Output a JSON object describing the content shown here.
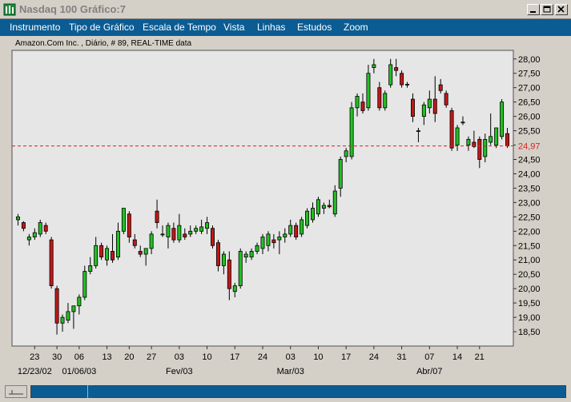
{
  "window": {
    "title": "Nasdaq 100 Gráfico:7",
    "minimize_icon": "minimize-icon",
    "maximize_icon": "maximize-icon",
    "close_icon": "close-icon"
  },
  "menu": {
    "items": [
      "Instrumento",
      "Tipo de Gráfico",
      "Escala de Tempo",
      "Vista",
      "Linhas",
      "Estudos",
      "Zoom"
    ]
  },
  "chart_header": "Amazon.Com Inc. , Diário, # 89, REAL-TIME data",
  "colors": {
    "up_candle": "#22c022",
    "down_candle": "#c01818",
    "reference_line": "#e02020",
    "menu_bg": "#0b5c93",
    "plot_bg": "#e6e6e6"
  },
  "chart_data": {
    "type": "candlestick",
    "y_ticks": [
      "28,00",
      "27,50",
      "27,00",
      "26,50",
      "26,00",
      "25,50",
      "25,00",
      "24,50",
      "24,00",
      "23,50",
      "23,00",
      "22,50",
      "22,00",
      "21,50",
      "21,00",
      "20,50",
      "20,00",
      "19,50",
      "19,00",
      "18,50"
    ],
    "ylim": [
      18.0,
      28.3
    ],
    "reference_line": {
      "value": 24.97,
      "label": "24,97"
    },
    "x_day_ticks": [
      {
        "label": "23",
        "index": 3
      },
      {
        "label": "30",
        "index": 7
      },
      {
        "label": "06",
        "index": 11
      },
      {
        "label": "13",
        "index": 16
      },
      {
        "label": "20",
        "index": 20
      },
      {
        "label": "27",
        "index": 24
      },
      {
        "label": "03",
        "index": 29
      },
      {
        "label": "10",
        "index": 34
      },
      {
        "label": "17",
        "index": 39
      },
      {
        "label": "24",
        "index": 44
      },
      {
        "label": "03",
        "index": 49
      },
      {
        "label": "10",
        "index": 54
      },
      {
        "label": "17",
        "index": 59
      },
      {
        "label": "24",
        "index": 64
      },
      {
        "label": "31",
        "index": 69
      },
      {
        "label": "07",
        "index": 74
      },
      {
        "label": "14",
        "index": 79
      },
      {
        "label": "21",
        "index": 83
      }
    ],
    "x_period_labels": [
      {
        "label": "12/23/02",
        "index": 3
      },
      {
        "label": "01/06/03",
        "index": 11
      },
      {
        "label": "Fev/03",
        "index": 29
      },
      {
        "label": "Mar/03",
        "index": 49
      },
      {
        "label": "Abr/07",
        "index": 74
      }
    ],
    "candles": [
      {
        "o": 22.4,
        "h": 22.6,
        "l": 22.2,
        "c": 22.5
      },
      {
        "o": 22.3,
        "h": 22.35,
        "l": 22.0,
        "c": 22.1
      },
      {
        "o": 21.7,
        "h": 21.9,
        "l": 21.5,
        "c": 21.8
      },
      {
        "o": 21.8,
        "h": 22.1,
        "l": 21.7,
        "c": 21.95
      },
      {
        "o": 21.9,
        "h": 22.4,
        "l": 21.8,
        "c": 22.3
      },
      {
        "o": 22.2,
        "h": 22.3,
        "l": 21.9,
        "c": 22.0
      },
      {
        "o": 21.7,
        "h": 21.8,
        "l": 20.0,
        "c": 20.1
      },
      {
        "o": 20.0,
        "h": 20.1,
        "l": 18.4,
        "c": 18.8
      },
      {
        "o": 18.8,
        "h": 19.1,
        "l": 18.5,
        "c": 19.0
      },
      {
        "o": 18.9,
        "h": 19.5,
        "l": 18.8,
        "c": 19.2
      },
      {
        "o": 19.2,
        "h": 19.3,
        "l": 18.6,
        "c": 19.4
      },
      {
        "o": 19.4,
        "h": 19.8,
        "l": 19.1,
        "c": 19.7
      },
      {
        "o": 19.7,
        "h": 20.8,
        "l": 19.6,
        "c": 20.6
      },
      {
        "o": 20.6,
        "h": 21.1,
        "l": 20.5,
        "c": 20.8
      },
      {
        "o": 20.8,
        "h": 21.8,
        "l": 20.7,
        "c": 21.5
      },
      {
        "o": 21.5,
        "h": 21.6,
        "l": 21.0,
        "c": 21.1
      },
      {
        "o": 21.0,
        "h": 21.5,
        "l": 20.8,
        "c": 21.4
      },
      {
        "o": 21.3,
        "h": 21.9,
        "l": 20.9,
        "c": 21.0
      },
      {
        "o": 21.1,
        "h": 22.3,
        "l": 21.0,
        "c": 22.0
      },
      {
        "o": 22.0,
        "h": 22.8,
        "l": 21.9,
        "c": 22.8
      },
      {
        "o": 22.6,
        "h": 22.7,
        "l": 21.6,
        "c": 21.8
      },
      {
        "o": 21.7,
        "h": 21.9,
        "l": 21.4,
        "c": 21.5
      },
      {
        "o": 21.3,
        "h": 21.5,
        "l": 21.1,
        "c": 21.2
      },
      {
        "o": 21.2,
        "h": 21.3,
        "l": 20.8,
        "c": 21.4
      },
      {
        "o": 21.4,
        "h": 22.0,
        "l": 21.2,
        "c": 21.9
      },
      {
        "o": 22.7,
        "h": 23.1,
        "l": 22.1,
        "c": 22.3
      },
      {
        "o": 21.9,
        "h": 22.2,
        "l": 21.8,
        "c": 21.9
      },
      {
        "o": 21.8,
        "h": 22.3,
        "l": 21.4,
        "c": 22.2
      },
      {
        "o": 22.1,
        "h": 22.3,
        "l": 21.6,
        "c": 21.7
      },
      {
        "o": 21.7,
        "h": 22.6,
        "l": 21.6,
        "c": 22.2
      },
      {
        "o": 21.9,
        "h": 22.1,
        "l": 21.7,
        "c": 21.8
      },
      {
        "o": 21.9,
        "h": 22.2,
        "l": 21.8,
        "c": 22.0
      },
      {
        "o": 22.0,
        "h": 22.2,
        "l": 21.9,
        "c": 22.1
      },
      {
        "o": 22.0,
        "h": 22.4,
        "l": 21.9,
        "c": 22.15
      },
      {
        "o": 22.1,
        "h": 22.5,
        "l": 21.9,
        "c": 22.3
      },
      {
        "o": 22.1,
        "h": 22.2,
        "l": 21.4,
        "c": 21.5
      },
      {
        "o": 21.6,
        "h": 21.7,
        "l": 20.6,
        "c": 20.8
      },
      {
        "o": 20.8,
        "h": 21.3,
        "l": 20.5,
        "c": 21.2
      },
      {
        "o": 21.0,
        "h": 21.3,
        "l": 19.6,
        "c": 20.0
      },
      {
        "o": 19.9,
        "h": 20.2,
        "l": 19.7,
        "c": 20.1
      },
      {
        "o": 20.1,
        "h": 21.4,
        "l": 20.0,
        "c": 21.3
      },
      {
        "o": 21.1,
        "h": 21.3,
        "l": 20.9,
        "c": 21.2
      },
      {
        "o": 21.1,
        "h": 21.4,
        "l": 21.0,
        "c": 21.3
      },
      {
        "o": 21.3,
        "h": 21.6,
        "l": 21.2,
        "c": 21.5
      },
      {
        "o": 21.4,
        "h": 21.9,
        "l": 21.2,
        "c": 21.8
      },
      {
        "o": 21.5,
        "h": 22.0,
        "l": 21.3,
        "c": 21.9
      },
      {
        "o": 21.7,
        "h": 21.9,
        "l": 21.4,
        "c": 21.6
      },
      {
        "o": 21.7,
        "h": 22.0,
        "l": 21.2,
        "c": 21.8
      },
      {
        "o": 21.8,
        "h": 22.1,
        "l": 21.6,
        "c": 21.9
      },
      {
        "o": 21.9,
        "h": 22.4,
        "l": 21.8,
        "c": 22.2
      },
      {
        "o": 22.2,
        "h": 22.3,
        "l": 21.7,
        "c": 21.8
      },
      {
        "o": 21.9,
        "h": 22.5,
        "l": 21.8,
        "c": 22.4
      },
      {
        "o": 22.2,
        "h": 22.8,
        "l": 22.1,
        "c": 22.7
      },
      {
        "o": 22.4,
        "h": 23.0,
        "l": 22.3,
        "c": 22.8
      },
      {
        "o": 22.6,
        "h": 23.2,
        "l": 22.5,
        "c": 23.1
      },
      {
        "o": 22.8,
        "h": 23.0,
        "l": 22.6,
        "c": 22.9
      },
      {
        "o": 22.9,
        "h": 23.1,
        "l": 22.8,
        "c": 22.85
      },
      {
        "o": 22.6,
        "h": 23.6,
        "l": 22.5,
        "c": 23.4
      },
      {
        "o": 23.5,
        "h": 24.6,
        "l": 23.2,
        "c": 24.5
      },
      {
        "o": 24.6,
        "h": 24.9,
        "l": 24.4,
        "c": 24.8
      },
      {
        "o": 24.6,
        "h": 26.5,
        "l": 24.5,
        "c": 26.3
      },
      {
        "o": 26.3,
        "h": 26.8,
        "l": 26.0,
        "c": 26.7
      },
      {
        "o": 26.5,
        "h": 26.8,
        "l": 26.1,
        "c": 26.2
      },
      {
        "o": 26.3,
        "h": 27.8,
        "l": 26.2,
        "c": 27.5
      },
      {
        "o": 27.7,
        "h": 28.0,
        "l": 27.5,
        "c": 27.8
      },
      {
        "o": 27.0,
        "h": 27.2,
        "l": 26.2,
        "c": 26.3
      },
      {
        "o": 26.3,
        "h": 26.9,
        "l": 26.2,
        "c": 26.8
      },
      {
        "o": 27.1,
        "h": 28.0,
        "l": 27.0,
        "c": 27.8
      },
      {
        "o": 27.7,
        "h": 28.0,
        "l": 27.4,
        "c": 27.6
      },
      {
        "o": 27.5,
        "h": 27.6,
        "l": 27.0,
        "c": 27.1
      },
      {
        "o": 27.1,
        "h": 27.2,
        "l": 27.0,
        "c": 27.12
      },
      {
        "o": 26.6,
        "h": 26.8,
        "l": 25.8,
        "c": 26.0
      },
      {
        "o": 25.5,
        "h": 25.6,
        "l": 25.1,
        "c": 25.5
      },
      {
        "o": 26.0,
        "h": 26.5,
        "l": 25.7,
        "c": 26.4
      },
      {
        "o": 26.3,
        "h": 26.9,
        "l": 26.1,
        "c": 26.6
      },
      {
        "o": 26.6,
        "h": 27.4,
        "l": 25.8,
        "c": 26.1
      },
      {
        "o": 27.1,
        "h": 27.3,
        "l": 26.8,
        "c": 26.9
      },
      {
        "o": 26.8,
        "h": 26.9,
        "l": 26.3,
        "c": 26.4
      },
      {
        "o": 26.2,
        "h": 26.3,
        "l": 24.8,
        "c": 24.9
      },
      {
        "o": 25.0,
        "h": 25.7,
        "l": 24.8,
        "c": 25.6
      },
      {
        "o": 25.8,
        "h": 26.0,
        "l": 25.7,
        "c": 25.8
      },
      {
        "o": 25.0,
        "h": 25.3,
        "l": 24.8,
        "c": 25.2
      },
      {
        "o": 25.1,
        "h": 25.5,
        "l": 24.9,
        "c": 24.95
      },
      {
        "o": 25.2,
        "h": 25.3,
        "l": 24.2,
        "c": 24.5
      },
      {
        "o": 24.6,
        "h": 25.4,
        "l": 24.4,
        "c": 25.2
      },
      {
        "o": 25.1,
        "h": 26.1,
        "l": 25.0,
        "c": 25.3
      },
      {
        "o": 25.0,
        "h": 25.6,
        "l": 24.9,
        "c": 25.6
      },
      {
        "o": 25.3,
        "h": 26.6,
        "l": 25.2,
        "c": 26.5
      },
      {
        "o": 25.4,
        "h": 25.6,
        "l": 24.9,
        "c": 24.97
      }
    ]
  }
}
